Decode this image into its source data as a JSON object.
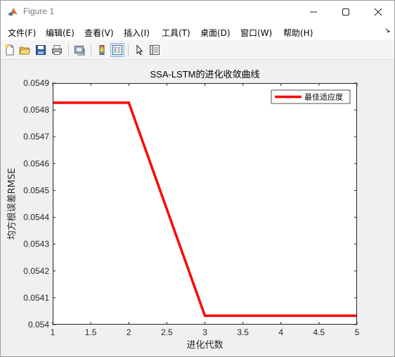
{
  "window": {
    "title": "Figure 1"
  },
  "menu": {
    "items": [
      "文件(F)",
      "编辑(E)",
      "查看(V)",
      "插入(I)",
      "工具(T)",
      "桌面(D)",
      "窗口(W)",
      "帮助(H)"
    ],
    "overflow_icon": "arrow-icon"
  },
  "toolbar": {
    "buttons": [
      "new-figure-icon",
      "open-file-icon",
      "save-icon",
      "print-icon",
      "link-plot-icon",
      "colorbar-icon",
      "legend-icon",
      "pointer-icon",
      "property-inspector-icon"
    ],
    "active": [
      "legend-icon"
    ]
  },
  "chart_data": {
    "type": "line",
    "title": "SSA-LSTM的进化收敛曲线",
    "xlabel": "进化代数",
    "ylabel": "均方根误差RMSE",
    "xlim": [
      1,
      5
    ],
    "ylim": [
      0.054,
      0.0549
    ],
    "x_ticks": [
      "1",
      "1.5",
      "2",
      "2.5",
      "3",
      "3.5",
      "4",
      "4.5",
      "5"
    ],
    "y_ticks": [
      "0.054",
      "0.0541",
      "0.0542",
      "0.0543",
      "0.0544",
      "0.0545",
      "0.0546",
      "0.0547",
      "0.0548",
      "0.0549"
    ],
    "series": [
      {
        "name": "最佳适应度",
        "color": "#ff0000",
        "x": [
          1,
          2,
          3,
          4,
          5
        ],
        "y": [
          0.054827,
          0.054827,
          0.054033,
          0.054033,
          0.054033
        ]
      }
    ],
    "legend": "top-right",
    "grid": false
  }
}
